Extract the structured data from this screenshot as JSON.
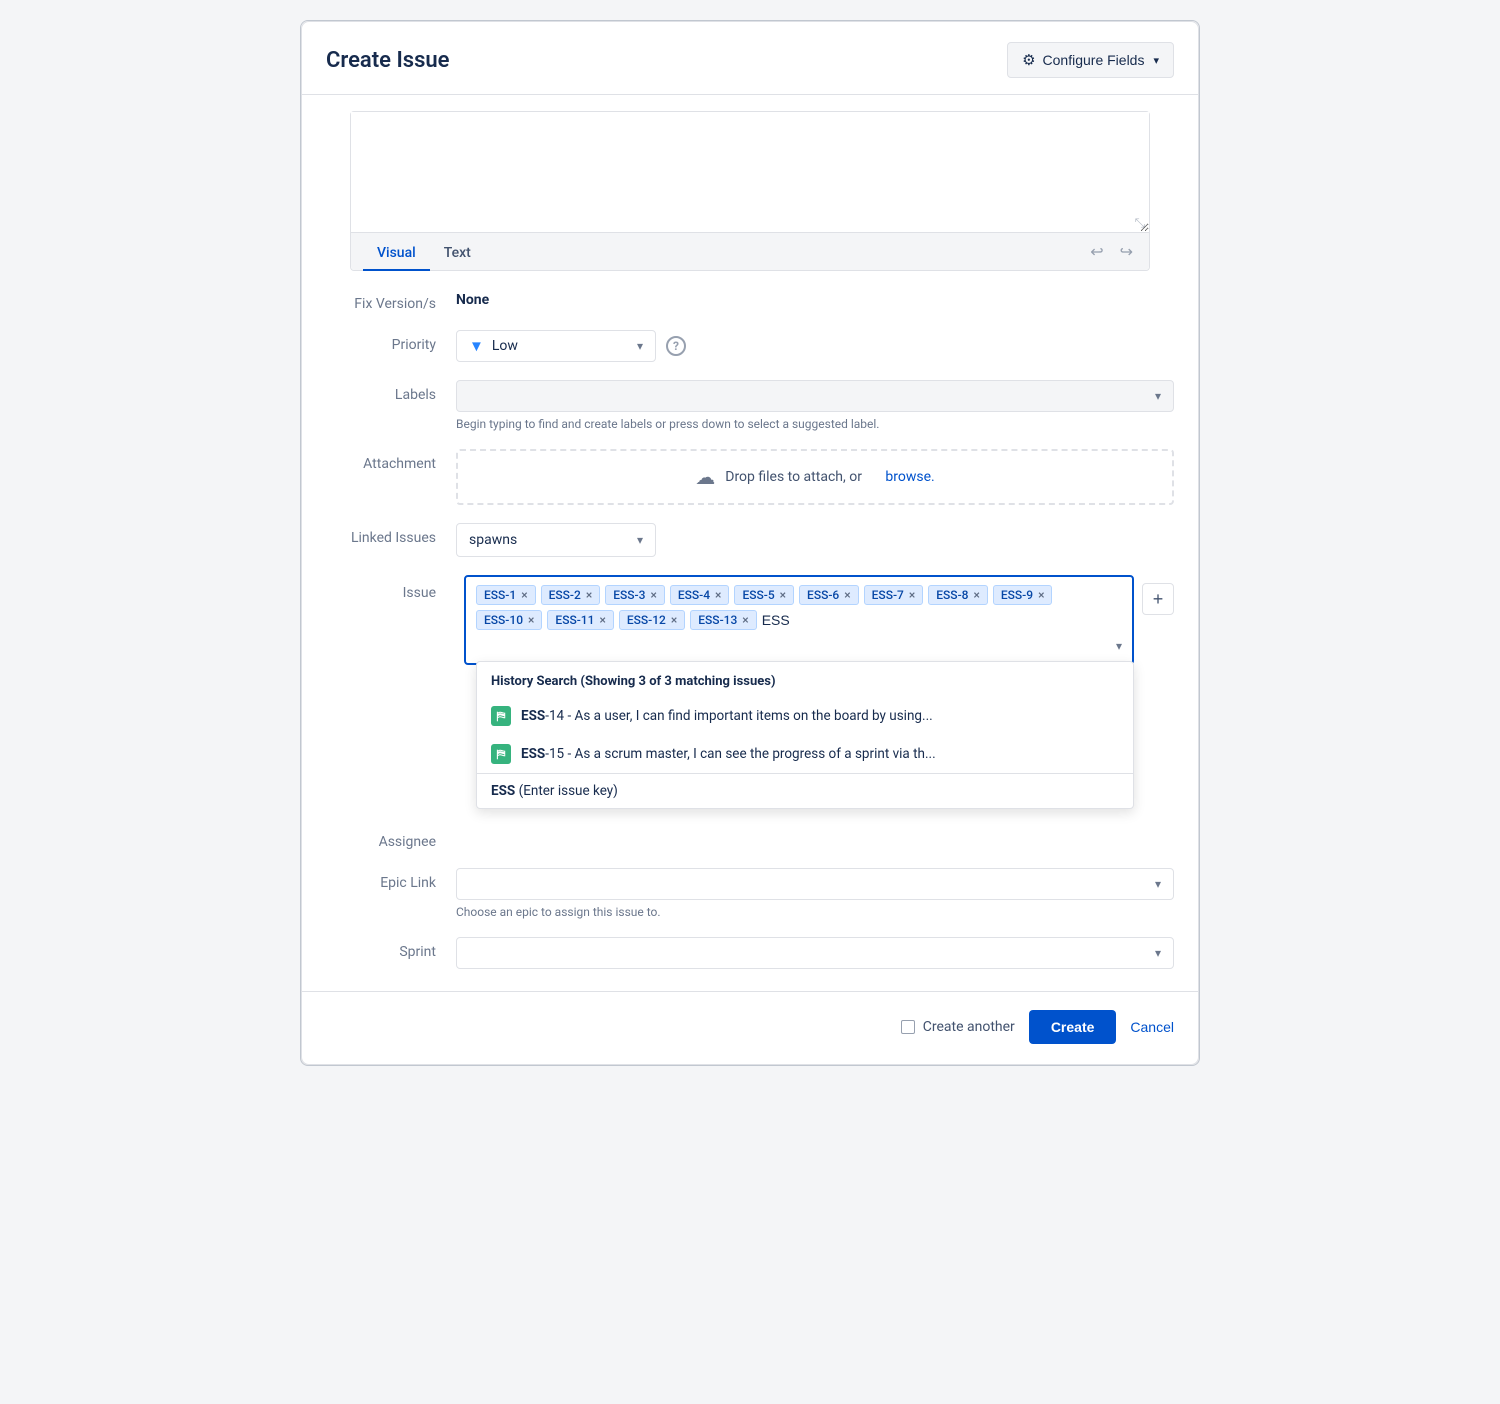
{
  "dialog": {
    "title": "Create Issue",
    "configure_fields_label": "Configure Fields"
  },
  "editor": {
    "visual_tab": "Visual",
    "text_tab": "Text",
    "active_tab": "Visual",
    "undo_icon": "↩",
    "redo_icon": "↪"
  },
  "form": {
    "fix_versions_label": "Fix Version/s",
    "fix_versions_value": "None",
    "priority_label": "Priority",
    "priority_value": "Low",
    "labels_label": "Labels",
    "labels_hint": "Begin typing to find and create labels or press down to select a suggested label.",
    "attachment_label": "Attachment",
    "attachment_hint": "Drop files to attach, or",
    "attachment_browse": "browse.",
    "linked_issues_label": "Linked Issues",
    "linked_issues_value": "spawns",
    "issue_label": "Issue",
    "assignee_label": "Assignee",
    "epic_link_label": "Epic Link",
    "epic_link_hint": "Choose an epic to assign this issue to.",
    "sprint_label": "Sprint"
  },
  "issue_tags": [
    "ESS-1",
    "ESS-2",
    "ESS-3",
    "ESS-4",
    "ESS-5",
    "ESS-6",
    "ESS-7",
    "ESS-8",
    "ESS-9",
    "ESS-10",
    "ESS-11",
    "ESS-12",
    "ESS-13"
  ],
  "issue_input_value": "ESS",
  "dropdown": {
    "header": "History Search (Showing 3 of 3 matching issues)",
    "items": [
      {
        "key": "ESS-14",
        "text": "As a user, I can find important items on the board by using..."
      },
      {
        "key": "ESS-15",
        "text": "As a scrum master, I can see the progress of a sprint via th..."
      }
    ],
    "enter_key_prefix": "ESS",
    "enter_key_suffix": "(Enter issue key)"
  },
  "footer": {
    "create_another_label": "Create another",
    "create_label": "Create",
    "cancel_label": "Cancel"
  },
  "icons": {
    "gear": "⚙",
    "chevron_down": "▾",
    "chevron_down_small": "▾",
    "undo": "↩",
    "redo": "↪",
    "upload": "⬆",
    "question": "?",
    "plus": "+",
    "bookmark": "⛿"
  }
}
